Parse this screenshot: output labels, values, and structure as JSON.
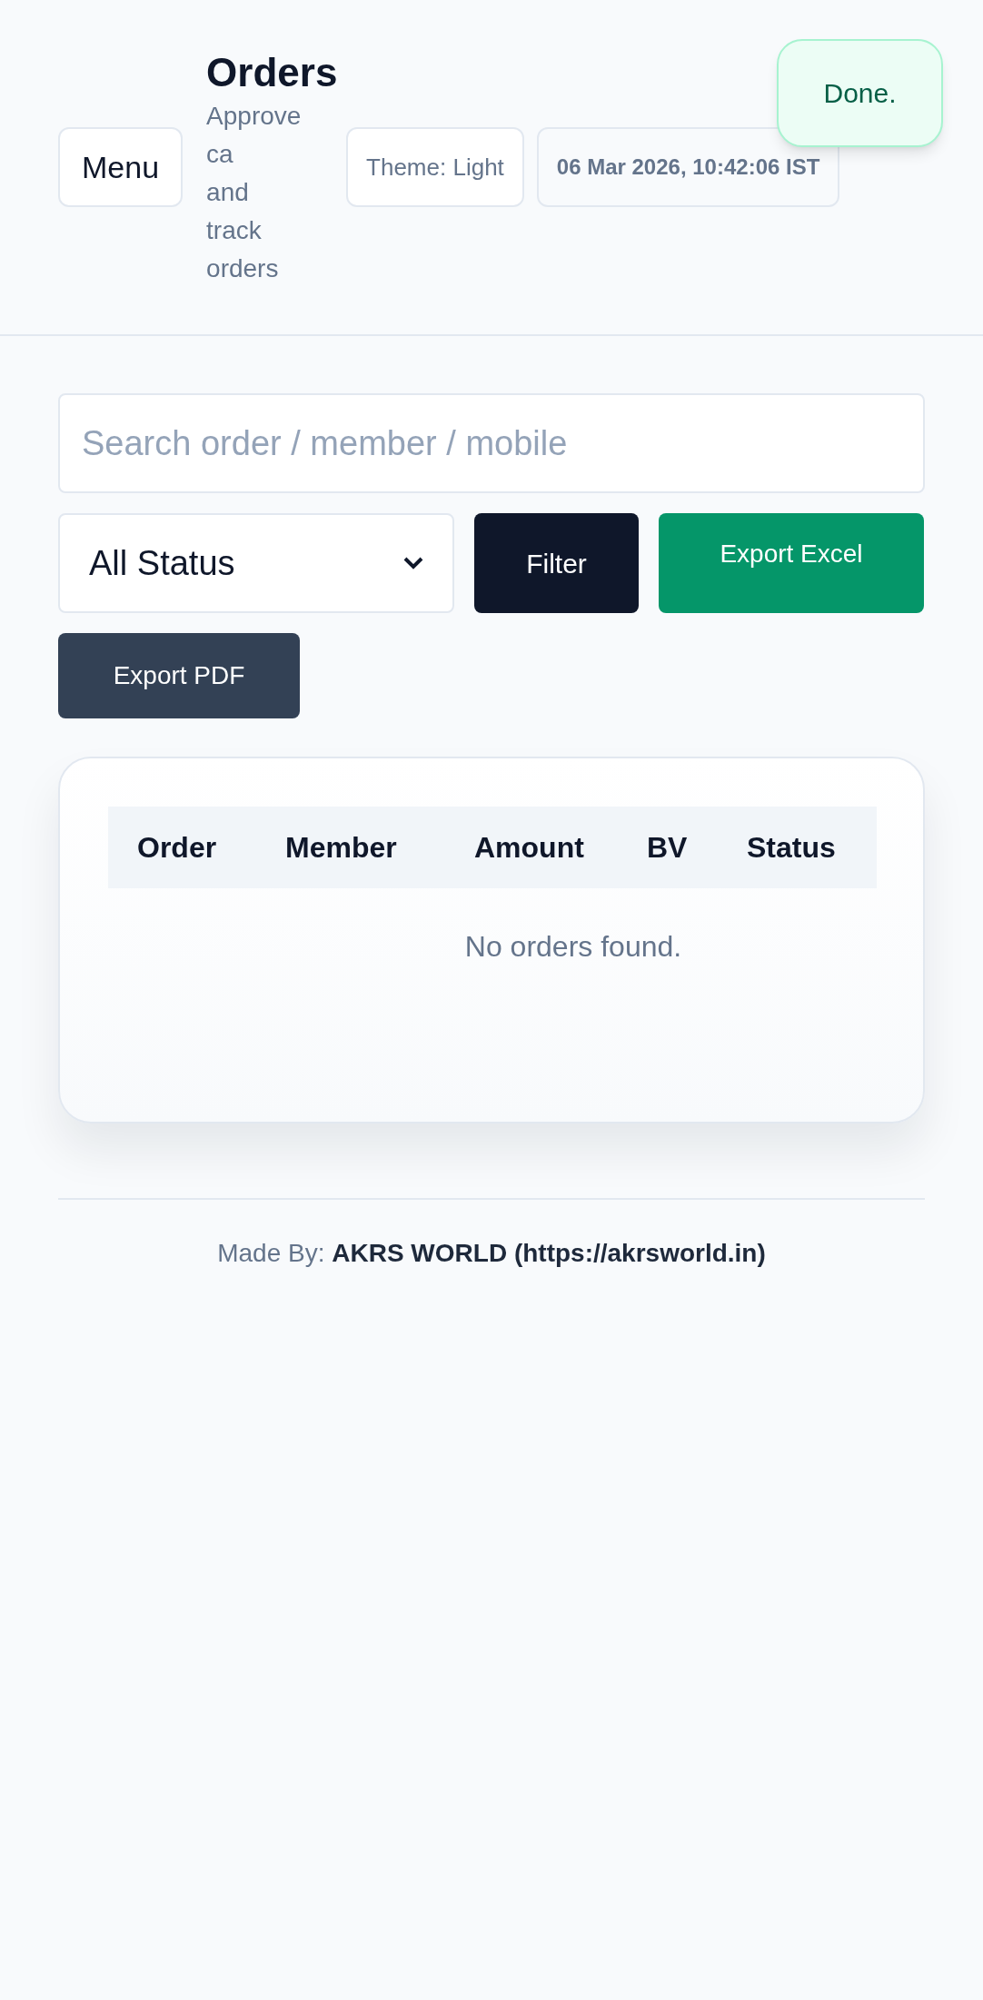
{
  "header": {
    "menu_button": "Menu",
    "title": "Orders",
    "subtitle_lines": [
      "Approve",
      "ca",
      "and",
      "track",
      "orders"
    ],
    "theme_button": "Theme: Light",
    "datetime": "06 Mar 2026, 10:42:06 IST"
  },
  "toast": {
    "text": "Done."
  },
  "filters": {
    "search": {
      "placeholder": "Search order / member / mobile"
    },
    "status_select": {
      "value": "All Status"
    },
    "buttons": [
      {
        "label": "Filter",
        "kind": "dark"
      },
      {
        "label": "Export Excel",
        "kind": "green"
      },
      {
        "label": "Export PDF",
        "kind": "slate"
      }
    ]
  },
  "table": {
    "columns": [
      "Order",
      "Member",
      "Amount",
      "BV",
      "Status"
    ],
    "empty_message": "No orders found."
  },
  "footer": {
    "text": "Made By: **AKRS WORLD (https://akrsworld.in)**"
  }
}
